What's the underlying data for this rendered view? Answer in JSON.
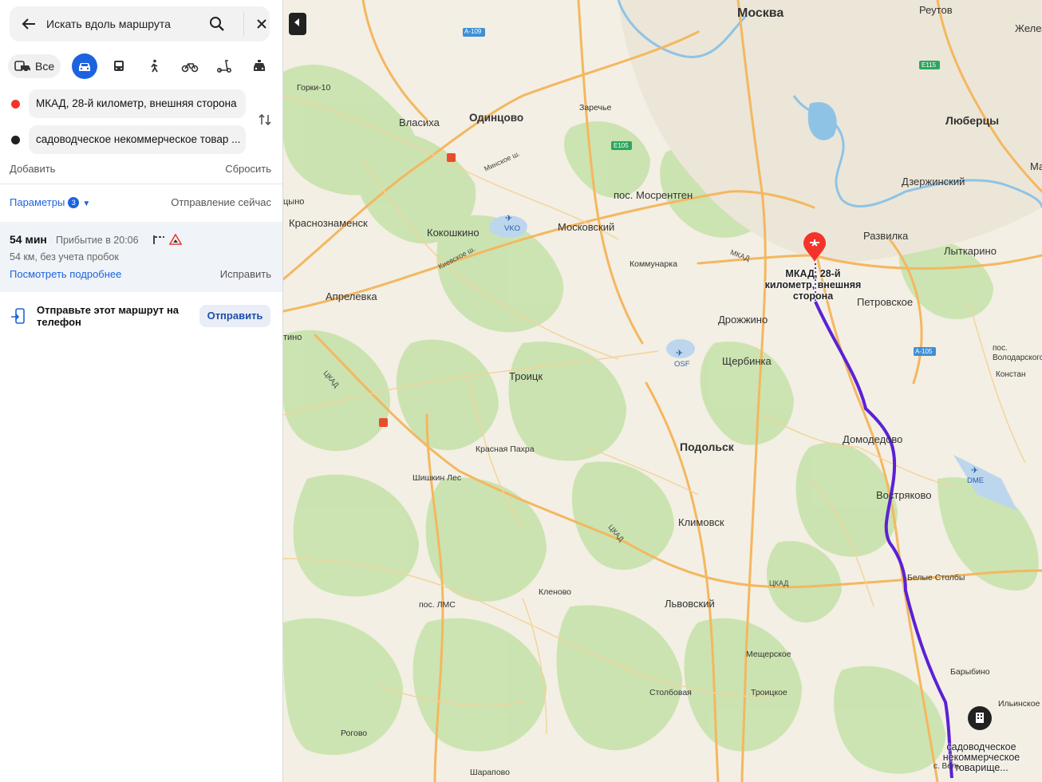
{
  "search": {
    "placeholder": "Искать вдоль маршрута"
  },
  "modes": {
    "all_label": "Все",
    "items": [
      "car-icon",
      "bus-icon",
      "walk-icon",
      "bicycle-icon",
      "scooter-icon",
      "taxi-icon"
    ],
    "active": "car-icon"
  },
  "waypoints": {
    "from": "МКАД, 28-й километр, внешняя сторона",
    "to": "садоводческое некоммерческое товар ...",
    "add_label": "Добавить",
    "reset_label": "Сбросить"
  },
  "params": {
    "label": "Параметры",
    "count": "3",
    "depart": "Отправление сейчас"
  },
  "route": {
    "time": "54 мин",
    "arrival": "Прибытие в 20:06",
    "distance": "54 км, без учета пробок",
    "details_link": "Посмотреть подробнее",
    "fix_link": "Исправить"
  },
  "send": {
    "text": "Отправьте этот маршрут на телефон",
    "button": "Отправить"
  },
  "map": {
    "labels": {
      "moscow": "Москва",
      "reutov": "Реутов",
      "zhelez": "Желез",
      "lyubertsy": "Люберцы",
      "ma": "Ма",
      "odintsovo": "Одинцово",
      "vlasikha": "Власиха",
      "gorki": "Горки-10",
      "zareche": "Заречье",
      "dzerzhinsky": "Дзержинский",
      "mosrentgen": "пос. Мосрентген",
      "krasnoznamensk": "Краснознаменск",
      "kokoshkino": "Кокошкино",
      "moskovsky": "Московский",
      "razvilka": "Развилка",
      "lytkarino": "Лыткарино",
      "kommunarka": "Коммунарка",
      "aprelevka": "Апрелевка",
      "petrovskoe": "Петровское",
      "drozhzhino": "Дрожжино",
      "shcherbinka": "Щербинка",
      "troitsk": "Троицк",
      "podolsk": "Подольск",
      "domodedovo": "Домодедово",
      "vostryakovo": "Востряково",
      "klimovsk": "Климовск",
      "krasnaya_pakhra": "Красная Пахра",
      "shishkin_les": "Шишкин Лес",
      "belye_stolby": "Белые Столбы",
      "klenovo": "Кленово",
      "lms": "пос. ЛМС",
      "lvovsky": "Львовский",
      "mescherskoe": "Мещерское",
      "barybino": "Барыбино",
      "stolbovaya": "Столбовая",
      "troitskoe": "Троицкое",
      "ilinskoe": "Ильинское",
      "rogovo": "Рогово",
      "sharapovo": "Шарапово",
      "volodarskogo": "пос. Володарского",
      "konst": "Констан",
      "tsyno": "цыно",
      "tino": "тино",
      "vko": "VKO",
      "osf": "OSF",
      "dme": "DME",
      "a109": "A-109",
      "e115": "E115",
      "e105": "E105",
      "a105": "A-105",
      "mkad": "МКАД",
      "tskad": "ЦКАД",
      "minskoe": "Минское ш.",
      "kievskoe": "Киевское ш.",
      "start_label": "МКАД, 28-й километр, внешняя сторона",
      "end_label": "садоводческое некоммерческое товарище...",
      "s_velt": "с. Вель"
    }
  },
  "colors": {
    "accent": "#1d63e0",
    "route": "#5b21d6",
    "start_pin": "#f4332b"
  }
}
